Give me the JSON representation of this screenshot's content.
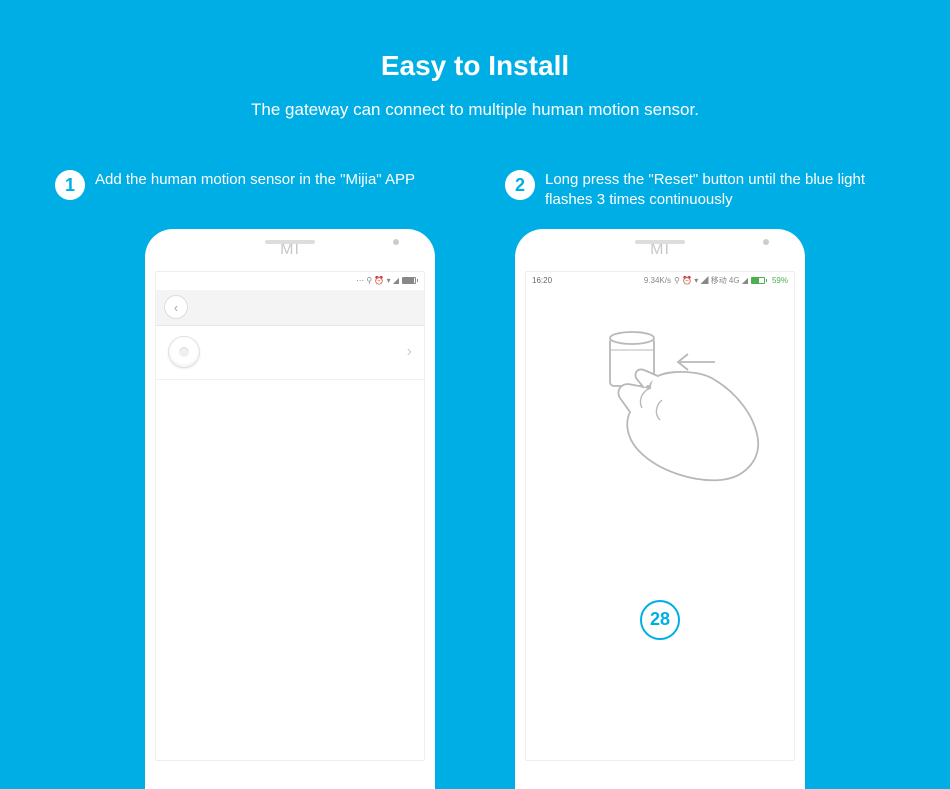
{
  "header": {
    "title": "Easy to Install",
    "subtitle": "The gateway can connect to multiple human motion sensor."
  },
  "steps": [
    {
      "num": "1",
      "text": "Add the human motion sensor in the \"Mijia\" APP"
    },
    {
      "num": "2",
      "text": "Long press the \"Reset\" button until the blue light flashes 3 times continuously"
    }
  ],
  "phone_left": {
    "logo": "MI",
    "statusbar": {
      "left": "",
      "right_icons": "⋯ ⚲ ⏰ ▾ ◢",
      "battery_pct": 90
    }
  },
  "phone_right": {
    "logo": "MI",
    "statusbar": {
      "time": "16:20",
      "net_speed": "9.34K/s",
      "right_icons": "⚲ ⏰ ▾ ◢ 移动 4G ◢",
      "battery_pct": 59,
      "battery_label": "59%"
    },
    "countdown": "28"
  }
}
